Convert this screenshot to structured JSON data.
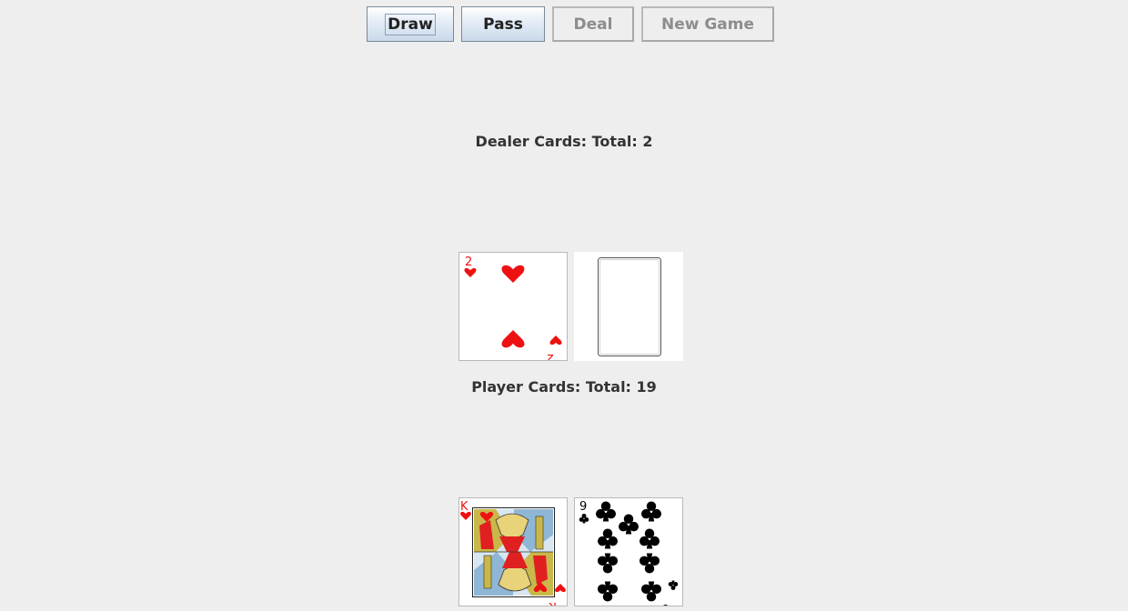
{
  "toolbar": {
    "draw_label": "Draw",
    "pass_label": "Pass",
    "deal_label": "Deal",
    "new_game_label": "New Game"
  },
  "dealer": {
    "label": "Dealer Cards: Total: 2",
    "cards": [
      {
        "rank": "2",
        "suit": "hearts",
        "face_up": true
      },
      {
        "face_up": false
      }
    ]
  },
  "player": {
    "label": "Player Cards: Total: 19",
    "cards": [
      {
        "rank": "K",
        "suit": "hearts",
        "face_up": true
      },
      {
        "rank": "9",
        "suit": "clubs",
        "face_up": true
      }
    ]
  },
  "colors": {
    "background": "#eeeeee",
    "red_suit": "#ee1111",
    "black_suit": "#000000",
    "enabled_button_text": "#222222",
    "disabled_button_text": "#8d8d8d"
  }
}
